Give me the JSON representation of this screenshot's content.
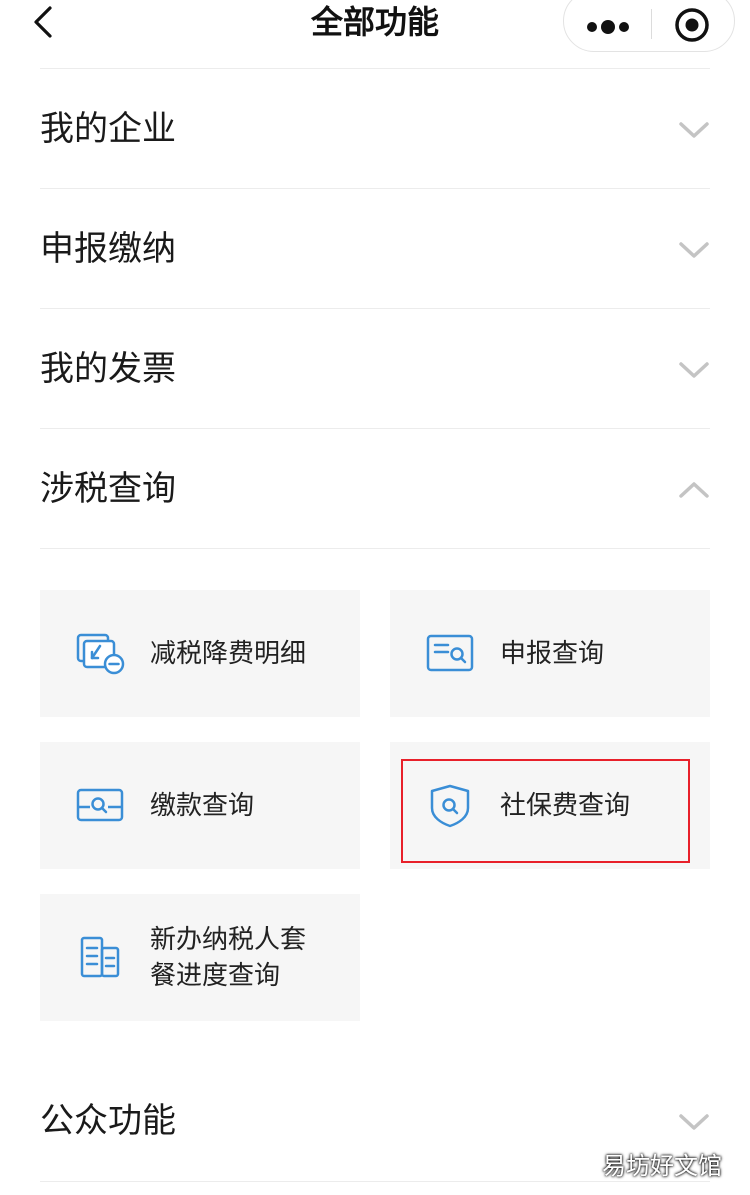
{
  "header": {
    "title": "全部功能"
  },
  "sections": [
    {
      "title": "我的企业"
    },
    {
      "title": "申报缴纳"
    },
    {
      "title": "我的发票"
    },
    {
      "title": "涉税查询"
    }
  ],
  "tiles": [
    {
      "label": "减税降费明细"
    },
    {
      "label": "申报查询"
    },
    {
      "label": "缴款查询"
    },
    {
      "label": "社保费查询"
    },
    {
      "label": "新办纳税人套餐进度查询"
    }
  ],
  "bottom_section": {
    "title": "公众功能"
  },
  "watermark": "易坊好文馆",
  "colors": {
    "icon_blue": "#3a8ed6",
    "highlight_red": "#e8202a",
    "tile_bg": "#f6f6f6"
  }
}
